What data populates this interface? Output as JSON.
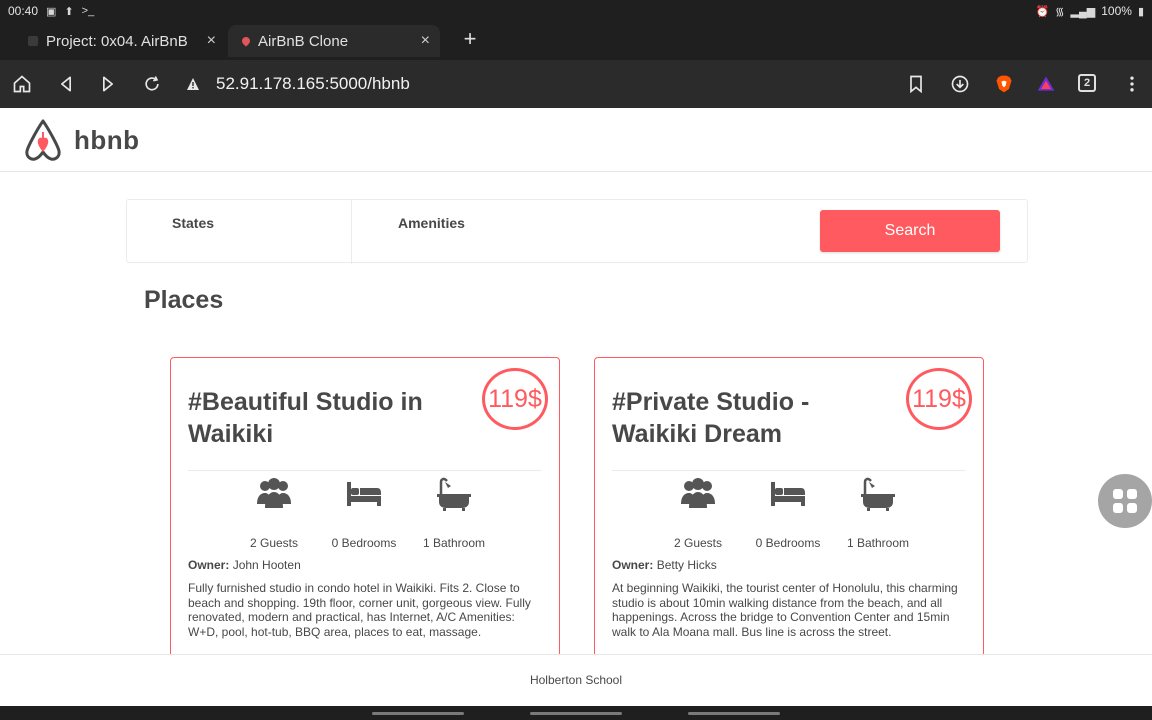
{
  "status_bar": {
    "time": "00:40",
    "left_icons": [
      "photo-icon",
      "upload-icon",
      "terminal-icon"
    ],
    "right_icons": [
      "alarm-icon",
      "wifi-icon",
      "signal-icon"
    ],
    "battery": "100%"
  },
  "tabs": [
    {
      "title": "Project: 0x04. AirBnB",
      "active": false
    },
    {
      "title": "AirBnB Clone",
      "active": true
    }
  ],
  "toolbar": {
    "url": "52.91.178.165:5000/hbnb",
    "tab_count": "2",
    "brave_color": "#ff5500"
  },
  "header": {
    "logo_text": "hbnb"
  },
  "filters": {
    "states_title": "States",
    "amenities_title": "Amenities",
    "search_label": "Search"
  },
  "places": {
    "title": "Places",
    "items": [
      {
        "name": "#Beautiful Studio in Waikiki",
        "price": "119$",
        "guests": "2 Guests",
        "bedrooms": "0 Bedrooms",
        "bathrooms": "1 Bathroom",
        "owner_label": "Owner:",
        "owner": "John Hooten",
        "description": "Fully furnished studio in condo hotel in Waikiki. Fits 2. Close to beach and shopping. 19th floor, corner unit, gorgeous view. Fully renovated, modern and practical, has Internet, A/C Amenities: W+D, pool, hot-tub, BBQ area, places to eat, massage."
      },
      {
        "name": "#Private Studio - Waikiki Dream",
        "price": "119$",
        "guests": "2 Guests",
        "bedrooms": "0 Bedrooms",
        "bathrooms": "1 Bathroom",
        "owner_label": "Owner:",
        "owner": "Betty Hicks",
        "description": "At beginning Waikiki, the tourist center of Honolulu, this charming studio is about 10min walking distance from the beach, and all happenings. Across the bridge to Convention Center and 15min walk to Ala Moana mall. Bus line is across the street."
      }
    ]
  },
  "footer": {
    "text": "Holberton School"
  },
  "colors": {
    "accent": "#ff5a5f",
    "text": "#484848"
  }
}
